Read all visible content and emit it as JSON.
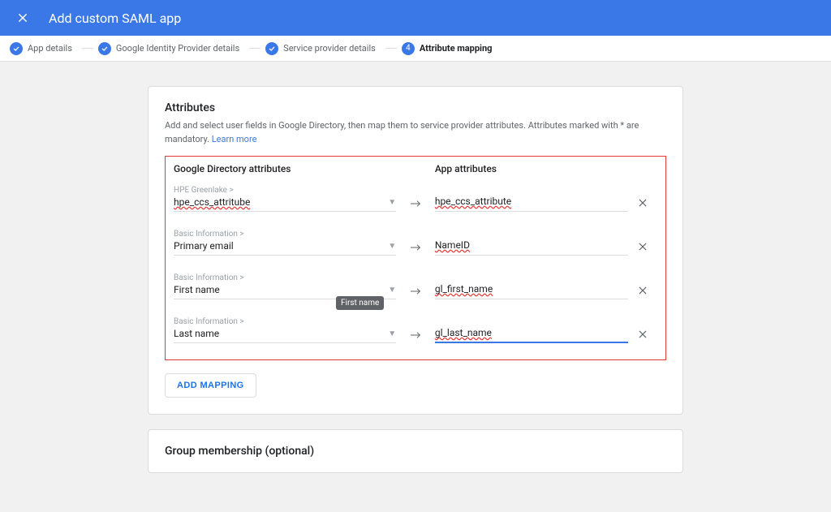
{
  "header": {
    "title": "Add custom SAML app"
  },
  "stepper": {
    "steps": [
      {
        "label": "App details",
        "done": true
      },
      {
        "label": "Google Identity Provider details",
        "done": true
      },
      {
        "label": "Service provider details",
        "done": true
      },
      {
        "label": "Attribute mapping",
        "number": "4",
        "active": true
      }
    ]
  },
  "attributes": {
    "title": "Attributes",
    "description": "Add and select user fields in Google Directory, then map them to service provider attributes. Attributes marked with * are mandatory.",
    "learn_more": "Learn more",
    "col_left": "Google Directory attributes",
    "col_right": "App attributes",
    "rows": [
      {
        "category": "HPE Greenlake >",
        "directory_value": "hpe_ccs_attritube",
        "app_value": "hpe_ccs_attribute"
      },
      {
        "category": "Basic Information >",
        "directory_value": "Primary email",
        "app_value": "NameID"
      },
      {
        "category": "Basic Information >",
        "directory_value": "First name",
        "app_value": "gl_first_name",
        "tooltip": "First name"
      },
      {
        "category": "Basic Information >",
        "directory_value": "Last name",
        "app_value": "gl_last_name",
        "focused": true
      }
    ],
    "add_mapping": "ADD MAPPING"
  },
  "group_card": {
    "title": "Group membership (optional)"
  }
}
